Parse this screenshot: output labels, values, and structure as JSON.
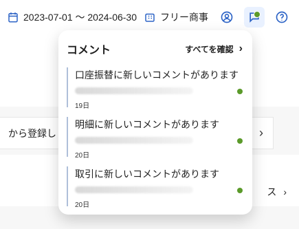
{
  "topbar": {
    "date_range": "2023-07-01 ～ 2024-06-30",
    "plan_label": "フリー商事",
    "icons": {
      "calendar": "calendar-icon",
      "plan": "building-icon",
      "account": "user-circle-icon",
      "comments": "comment-icon",
      "help": "help-icon"
    }
  },
  "background": {
    "register_text": "から登録し",
    "line_item_suffix_text": "ス"
  },
  "popover": {
    "title": "コメント",
    "view_all_label": "すべてを確認",
    "notifications": [
      {
        "title": "口座振替に新しいコメントがあります",
        "date": "19日"
      },
      {
        "title": "明細に新しいコメントがあります",
        "date": "20日"
      },
      {
        "title": "取引に新しいコメントがあります",
        "date": "20日"
      }
    ]
  },
  "colors": {
    "accent": "#2c63c6",
    "unread_dot": "#5b9a2a"
  }
}
